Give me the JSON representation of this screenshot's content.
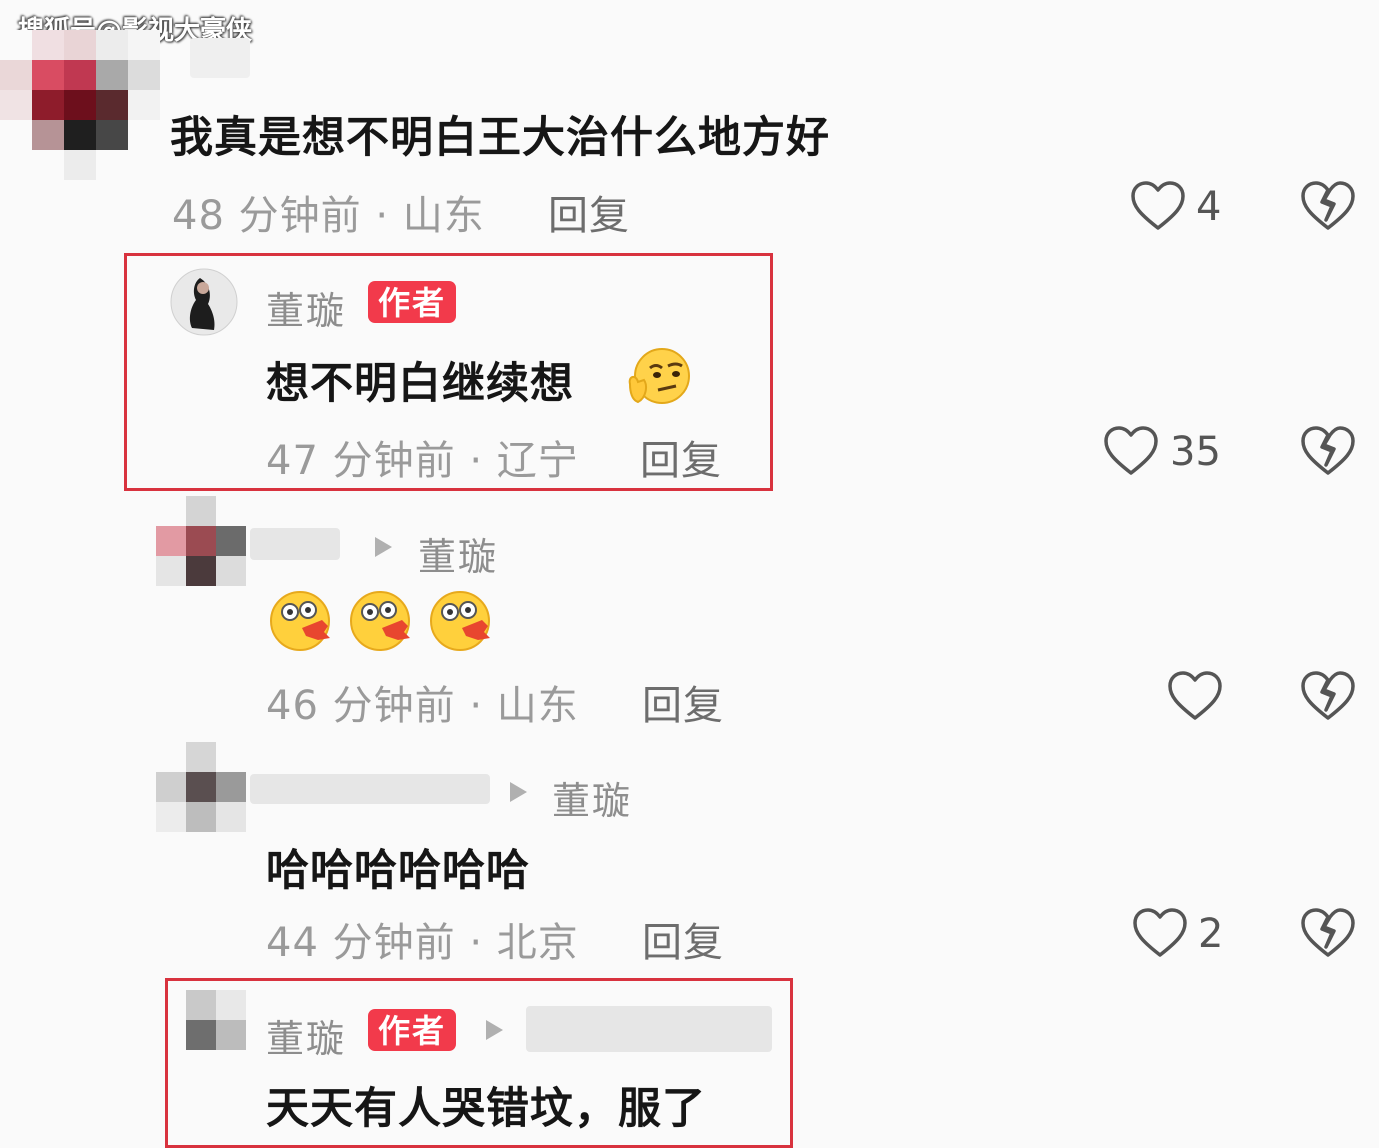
{
  "watermark": "搜狐号@影视大豪侠",
  "author_badge": "作者",
  "comments": [
    {
      "text": "我真是想不明白王大治什么地方好",
      "time": "48 分钟前 · 山东",
      "reply": "回复",
      "likes": "4"
    },
    {
      "user": "董璇",
      "text": "想不明白继续想",
      "time": "47 分钟前 · 辽宁",
      "reply": "回复",
      "likes": "35"
    },
    {
      "reply_to": "董璇",
      "time": "46 分钟前 · 山东",
      "reply": "回复",
      "likes": ""
    },
    {
      "reply_to": "董璇",
      "text": "哈哈哈哈哈哈",
      "time": "44 分钟前 · 北京",
      "reply": "回复",
      "likes": "2"
    },
    {
      "user": "董璇",
      "text": "天天有人哭错坟，服了"
    }
  ],
  "icons": {
    "like": "heart-outline-icon",
    "dislike": "broken-heart-icon",
    "reply_arrow": "play-triangle-icon",
    "emoji_thinking": "thinking-face-emoji",
    "emoji_surprised": "surprised-face-emoji"
  },
  "colors": {
    "accent": "#f23a4b",
    "highlight_box": "#d8323e"
  }
}
